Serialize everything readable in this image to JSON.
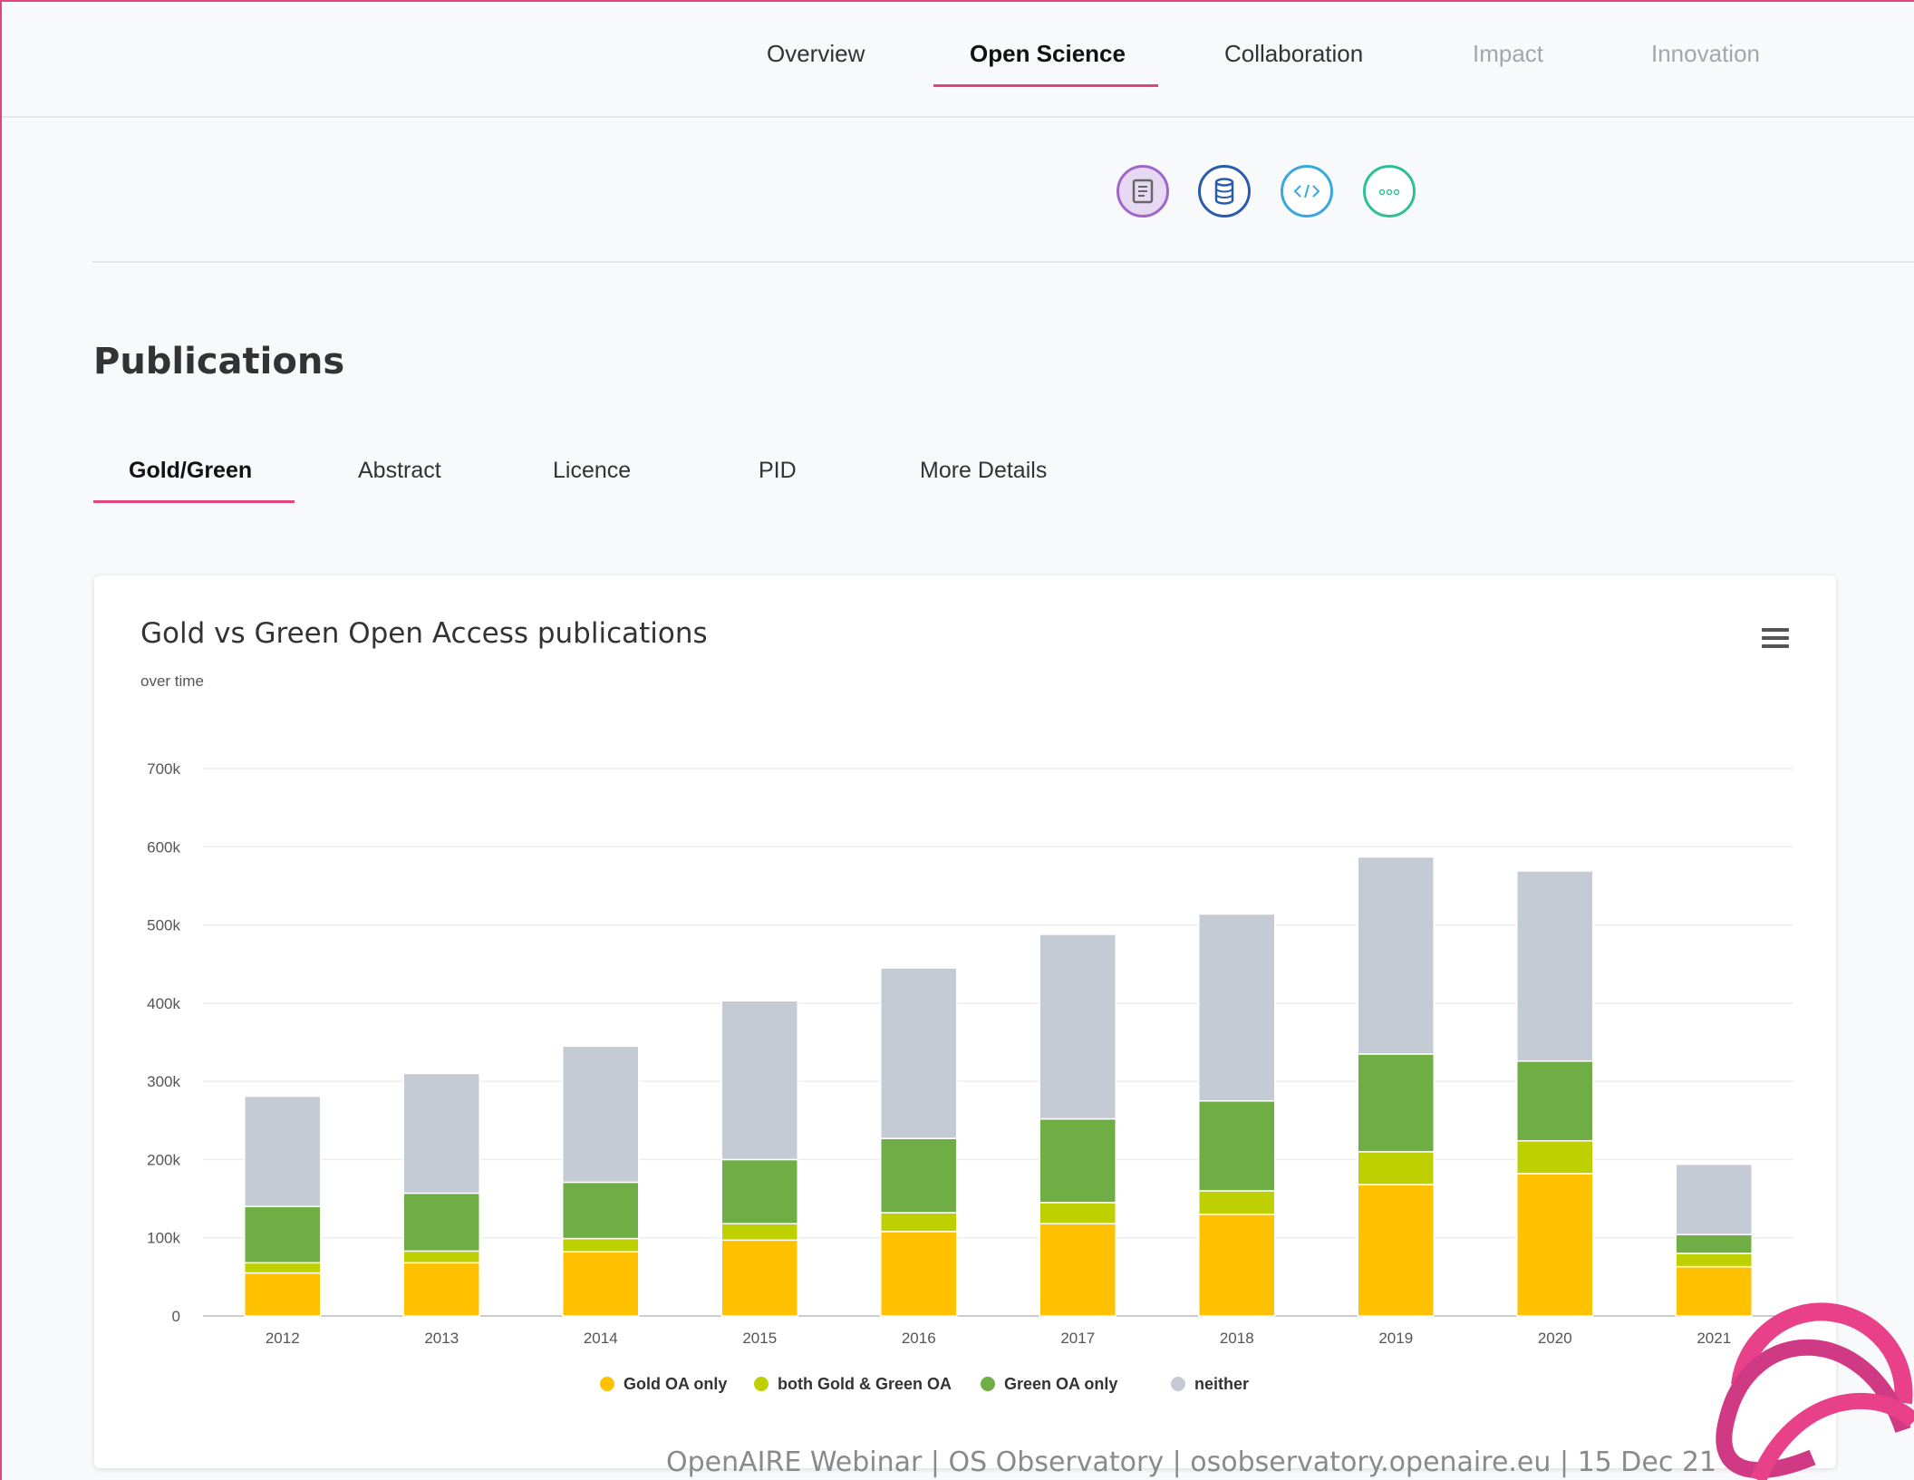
{
  "nav": {
    "items": [
      {
        "label": "Overview",
        "state": "normal"
      },
      {
        "label": "Open Science",
        "state": "active"
      },
      {
        "label": "Collaboration",
        "state": "normal"
      },
      {
        "label": "Impact",
        "state": "disabled"
      },
      {
        "label": "Innovation",
        "state": "disabled"
      }
    ]
  },
  "icons": [
    {
      "name": "publications-icon",
      "color": "#a066c9",
      "fill": "#e7d9f3"
    },
    {
      "name": "datasets-icon",
      "color": "#2a5cad",
      "fill": "#ffffff"
    },
    {
      "name": "software-icon",
      "color": "#3aa8e0",
      "fill": "#ffffff"
    },
    {
      "name": "other-products-icon",
      "color": "#2fbf95",
      "fill": "#ffffff"
    }
  ],
  "section": {
    "title": "Publications"
  },
  "subtabs": [
    {
      "label": "Gold/Green"
    },
    {
      "label": "Abstract"
    },
    {
      "label": "Licence"
    },
    {
      "label": "PID"
    },
    {
      "label": "More Details"
    }
  ],
  "chart_data": {
    "type": "bar",
    "stacked": true,
    "title": "Gold vs Green Open Access publications",
    "subtitle": "over time",
    "categories": [
      "2012",
      "2013",
      "2014",
      "2015",
      "2016",
      "2017",
      "2018",
      "2019",
      "2020",
      "2021"
    ],
    "y_tick_labels": [
      "0",
      "100k",
      "200k",
      "300k",
      "400k",
      "500k",
      "600k",
      "700k"
    ],
    "ylim": [
      0,
      700000
    ],
    "grid": true,
    "legend_position": "bottom-center",
    "series": [
      {
        "name": "Gold OA only",
        "color": "#ffc100",
        "values": [
          55000,
          68000,
          82000,
          97000,
          108000,
          118000,
          130000,
          168000,
          182000,
          63000
        ]
      },
      {
        "name": "both Gold & Green OA",
        "color": "#bed000",
        "values": [
          13000,
          15000,
          17000,
          21000,
          24000,
          27000,
          30000,
          42000,
          42000,
          17000
        ]
      },
      {
        "name": "Green OA only",
        "color": "#6fae45",
        "values": [
          72000,
          74000,
          72000,
          82000,
          95000,
          107000,
          115000,
          125000,
          102000,
          24000
        ]
      },
      {
        "name": "neither",
        "color": "#c5cbd4",
        "values": [
          141000,
          153000,
          174000,
          203000,
          218000,
          236000,
          239000,
          252000,
          243000,
          90000
        ]
      }
    ]
  },
  "footer": {
    "text": "OpenAIRE Webinar  |  OS Observatory  |  osobservatory.openaire.eu  |  15 Dec 21"
  },
  "colors": {
    "accent": "#e0457b"
  }
}
